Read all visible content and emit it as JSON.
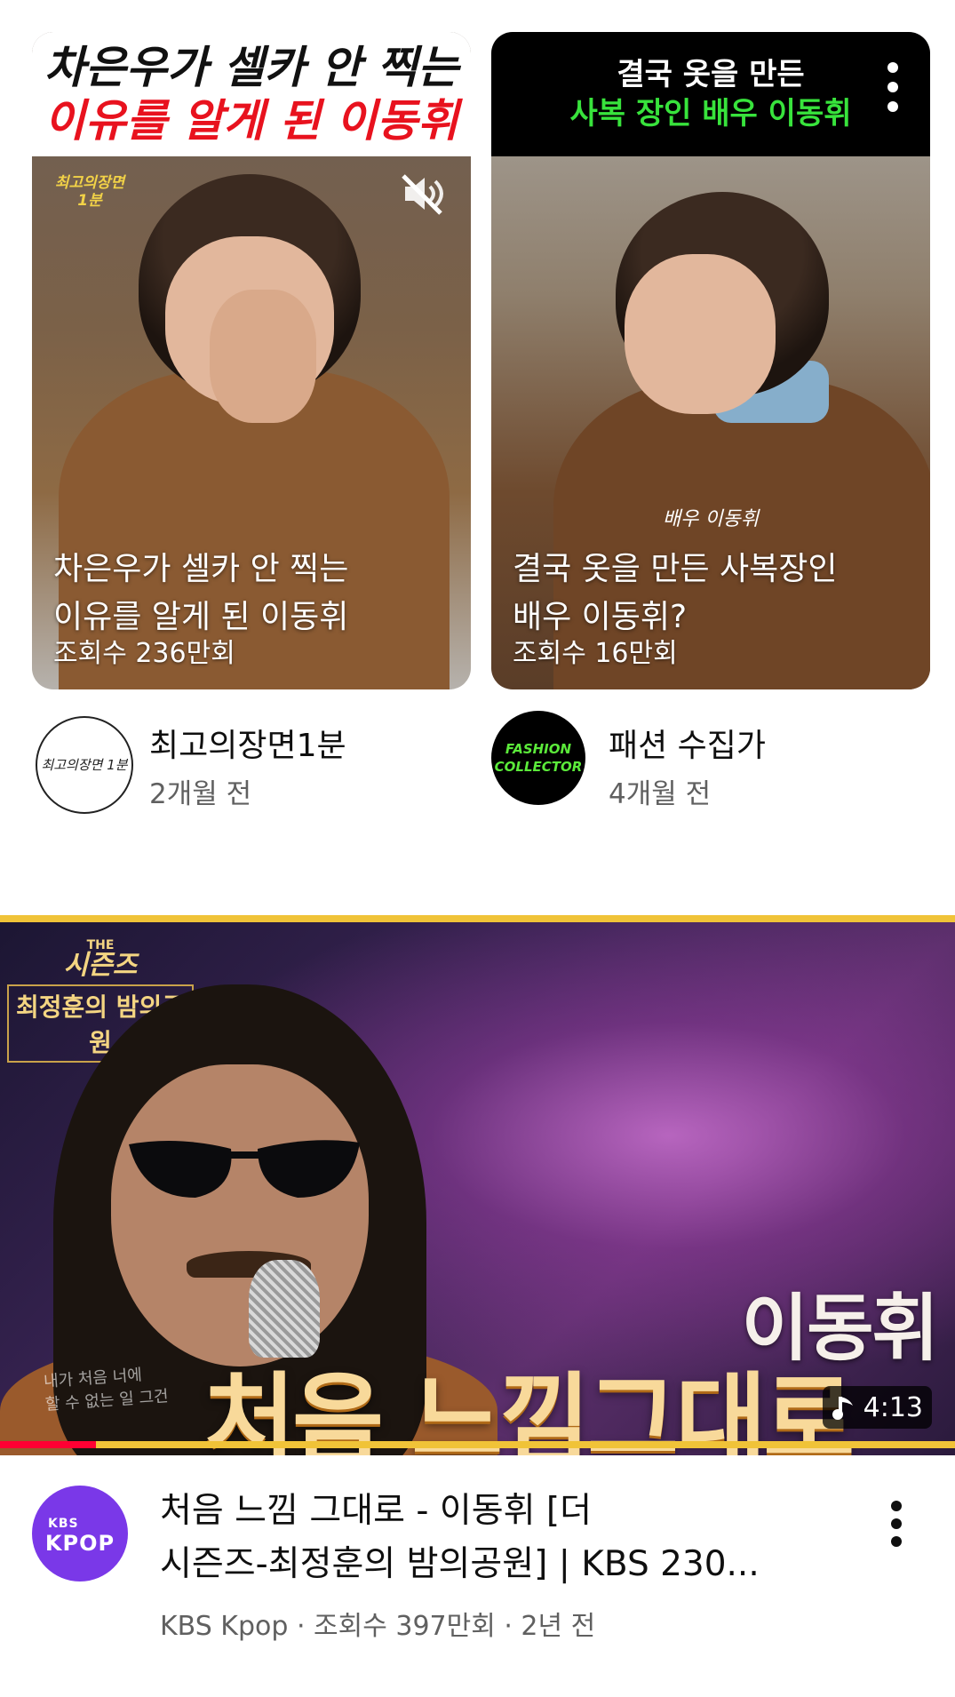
{
  "shorts": [
    {
      "banner_line1": "차은우가 셀카 안 찍는",
      "banner_line2": "이유를 알게 된 이동휘",
      "channel_tag": "최고의장면 1분",
      "overlay_title": "차은우가 셀카 안 찍는\n이유를 알게 된 이동휘",
      "views": "조회수 236만회",
      "channel_avatar_text": "최고의장면 1분",
      "channel_name": "최고의장면1분",
      "time_ago": "2개월 전",
      "icon": "mute-icon"
    },
    {
      "banner_line1": "결국 옷을 만든",
      "banner_line2": "사복 장인 배우 이동휘",
      "overlay_tag": "배우 이동휘",
      "overlay_title": "결국 옷을 만든 사복장인\n배우 이동휘?",
      "views": "조회수 16만회",
      "channel_avatar_text": "FASHION COLLECTOR",
      "channel_name": "패션 수집가",
      "time_ago": "4개월 전",
      "icon": "more-vert-icon"
    }
  ],
  "video": {
    "show_logo_small": "THE",
    "show_logo_main": "시즌즈",
    "show_logo_sub": "최정훈의 밤의공원",
    "thumb_name": "이동휘",
    "thumb_title": "처음 느낌그대로",
    "thumb_lyric": "내가 처음 너에\n할 수 없는 일 그건",
    "duration": "4:13",
    "watch_progress": 0.1,
    "channel_avatar_line1": "KBS",
    "channel_avatar_line2": "KPOP",
    "title": "처음 느낌 그대로 - 이동휘 [더\n시즌즈-최정훈의 밤의공원] | KBS 230...",
    "subtitle": "KBS Kpop · 조회수 397만회 · 2년 전"
  },
  "colors": {
    "accent_red": "#e8121e",
    "accent_green": "#38e33c",
    "progress_red": "#ff0033",
    "frame_gold": "#f0c338",
    "kbs_purple": "#7a38e8"
  }
}
